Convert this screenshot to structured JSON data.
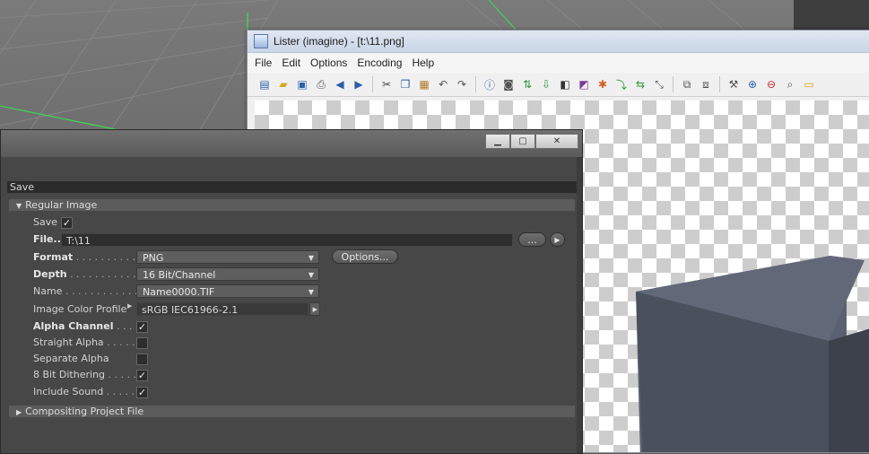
{
  "lister": {
    "title": "Lister (imagine) - [t:\\11.png]",
    "menu": [
      "File",
      "Edit",
      "Options",
      "Encoding",
      "Help"
    ]
  },
  "save_dialog": {
    "section": "Save",
    "group_regular": "Regular Image",
    "save_label": "Save",
    "file_label": "File...",
    "file_value": "T:\\11",
    "file_browse": "...",
    "format_label": "Format",
    "format_value": "PNG",
    "options_button": "Options...",
    "depth_label": "Depth",
    "depth_value": "16 Bit/Channel",
    "name_label": "Name",
    "name_value": "Name0000.TIF",
    "profile_label": "Image Color Profile",
    "profile_value": "sRGB IEC61966-2.1",
    "alpha_label": "Alpha Channel",
    "straight_label": "Straight Alpha",
    "separate_label": "Separate Alpha",
    "dither_label": "8 Bit Dithering",
    "sound_label": "Include Sound",
    "group_compositing": "Compositing Project File",
    "checks": {
      "save": true,
      "alpha": true,
      "straight": false,
      "separate": false,
      "dither": true,
      "sound": true
    }
  },
  "colors": {
    "grid_line": "#33d24a",
    "cube": "#4a4f58"
  }
}
